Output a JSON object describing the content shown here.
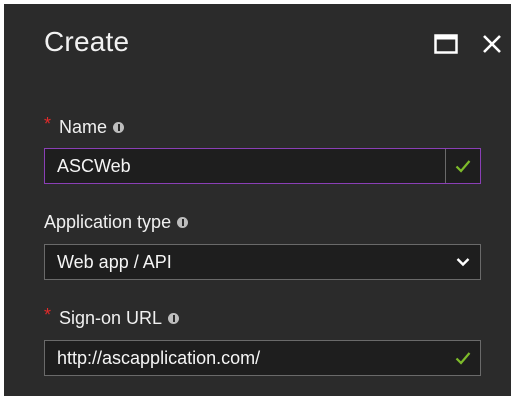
{
  "dialog": {
    "title": "Create"
  },
  "window_controls": {
    "maximize_icon": "maximize-icon",
    "close_icon": "close-icon"
  },
  "form": {
    "name": {
      "label": "Name",
      "required_marker": "*",
      "value": "ASCWeb",
      "valid": true
    },
    "application_type": {
      "label": "Application type",
      "selected": "Web app / API"
    },
    "sign_on_url": {
      "label": "Sign-on URL",
      "required_marker": "*",
      "value": "http://ascapplication.com/",
      "valid": true
    }
  },
  "colors": {
    "panel_bg": "#2b2b2b",
    "field_bg": "#1e1e1e",
    "focus_border": "#8a3fb6",
    "valid_check": "#7dbb2a",
    "required": "#e02b2b"
  }
}
